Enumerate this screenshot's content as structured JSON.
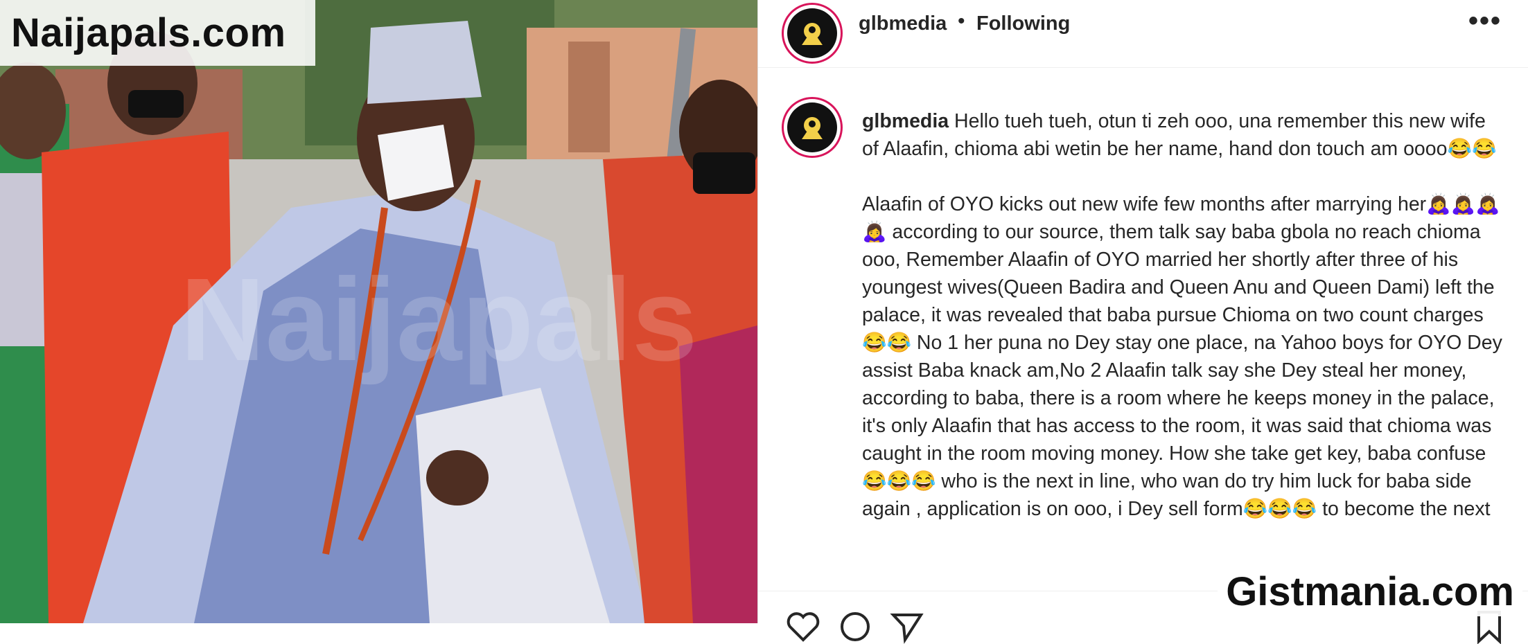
{
  "watermarks": {
    "top_left": "Naijapals.com",
    "bottom_right": "Gistmania.com"
  },
  "post": {
    "username": "glbmedia",
    "separator": "•",
    "follow_status": "Following",
    "more_icon": "more-horizontal-icon"
  },
  "caption": {
    "username": "glbmedia",
    "para1": "Hello tueh tueh, otun ti zeh ooo, una remember this new wife of Alaafin, chioma abi wetin be her name, hand don touch am oooo😂😂",
    "para2": "Alaafin of OYO kicks out new wife few months after marrying her🙇‍♀️🙇‍♀️🙇‍♀️🙇‍♀️ according to our source, them talk say baba gbola no reach chioma ooo, Remember Alaafin of OYO married her shortly after three of his youngest wives(Queen Badira and Queen Anu and Queen Dami) left the palace, it was revealed that baba pursue Chioma on two count charges😂😂 No 1 her puna no Dey stay one place, na Yahoo boys for OYO Dey assist Baba knack am,No 2 Alaafin talk say she Dey steal her money, according to baba, there is a room where he keeps money in the palace, it's only Alaafin that has access to the room, it was said that chioma was caught in the room moving money. How she take get key, baba confuse 😂😂😂 who is the next in line, who wan do try him luck for baba side again , application is on ooo, i Dey sell form😂😂😂 to become the next"
  },
  "actions": [
    "heart-icon",
    "comment-icon",
    "share-icon",
    "bookmark-icon"
  ],
  "colors": {
    "avatar_ring": "#d8145a",
    "text": "#262626"
  }
}
